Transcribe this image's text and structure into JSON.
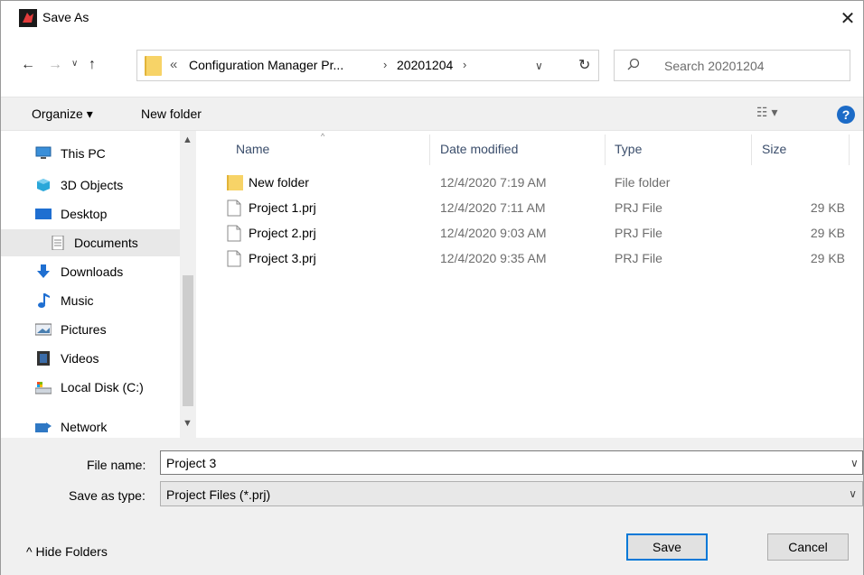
{
  "window": {
    "title": "Save As",
    "close_glyph": "✕"
  },
  "address": {
    "prefix_glyph": "«",
    "crumbs": [
      "Configuration Manager Pr...",
      "20201204"
    ],
    "separator_glyph": "›",
    "search_placeholder": "Search 20201204"
  },
  "toolbar": {
    "organize_label": "Organize ▾",
    "new_folder_label": "New folder",
    "view_glyph": "☷ ▾",
    "help_glyph": "?"
  },
  "nav": {
    "items": [
      {
        "label": "This PC",
        "icon": "pc-icon"
      },
      {
        "label": "3D Objects",
        "icon": "cube-icon"
      },
      {
        "label": "Desktop",
        "icon": "desktop-icon"
      },
      {
        "label": "Documents",
        "icon": "documents-icon",
        "selected": true
      },
      {
        "label": "Downloads",
        "icon": "download-arrow-icon"
      },
      {
        "label": "Music",
        "icon": "music-note-icon"
      },
      {
        "label": "Pictures",
        "icon": "pictures-icon"
      },
      {
        "label": "Videos",
        "icon": "videos-icon"
      },
      {
        "label": "Local Disk (C:)",
        "icon": "drive-icon"
      },
      {
        "label": "Network",
        "icon": "network-icon"
      }
    ]
  },
  "files": {
    "columns": [
      "Name",
      "Date modified",
      "Type",
      "Size"
    ],
    "rows": [
      {
        "name": "New folder",
        "date": "12/4/2020 7:19 AM",
        "type": "File folder",
        "size": "",
        "kind": "folder"
      },
      {
        "name": "Project 1.prj",
        "date": "12/4/2020 7:11 AM",
        "type": "PRJ File",
        "size": "29 KB",
        "kind": "file"
      },
      {
        "name": "Project 2.prj",
        "date": "12/4/2020 9:03 AM",
        "type": "PRJ File",
        "size": "29 KB",
        "kind": "file"
      },
      {
        "name": "Project 3.prj",
        "date": "12/4/2020 9:35 AM",
        "type": "PRJ File",
        "size": "29 KB",
        "kind": "file"
      }
    ]
  },
  "form": {
    "file_name_label": "File name:",
    "file_name_value": "Project 3",
    "save_type_label": "Save as type:",
    "save_type_value": "Project Files (*.prj)"
  },
  "footer": {
    "hide_folders_label": "^  Hide Folders",
    "save_label": "Save",
    "cancel_label": "Cancel"
  },
  "colors": {
    "accent": "#0078d7",
    "folder": "#f7d367",
    "help": "#1c6bc7"
  }
}
